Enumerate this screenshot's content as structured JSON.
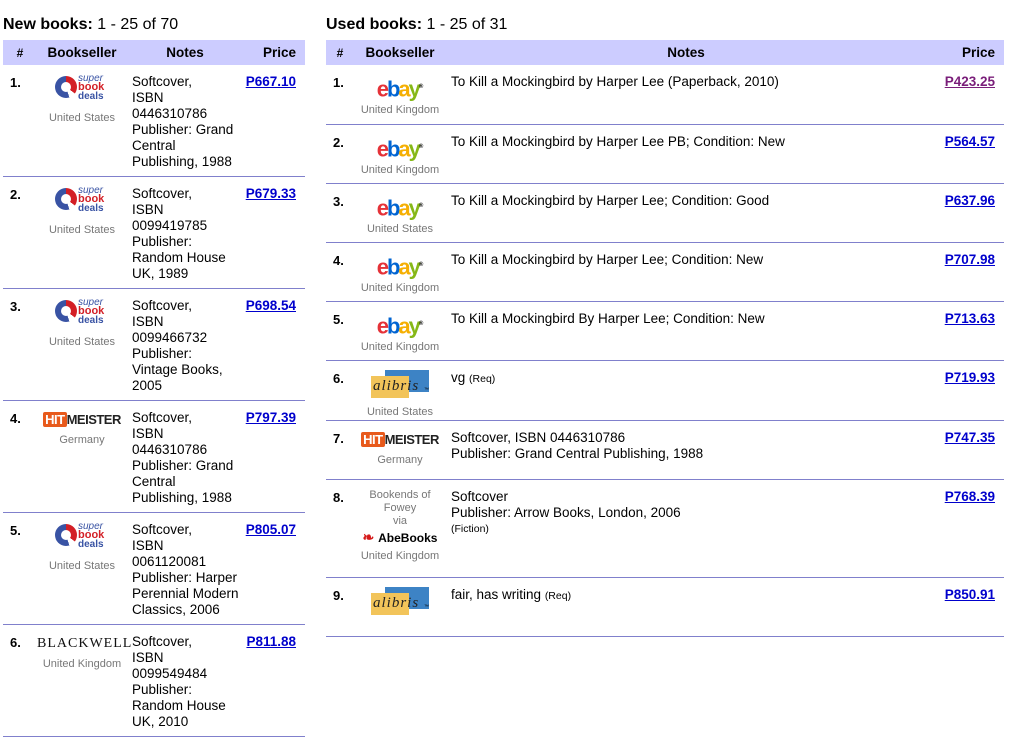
{
  "new_books": {
    "heading_bold": "New books:",
    "heading_count": "1 - 25 of 70",
    "columns": [
      "#",
      "Bookseller",
      "Notes",
      "Price"
    ],
    "rows": [
      {
        "num": "1.",
        "seller_logo": "superbookdeals-logo",
        "country": "United States",
        "notes": [
          "Softcover,",
          "ISBN 0446310786",
          "Publisher: Grand",
          "Central",
          "Publishing, 1988"
        ],
        "price": "P667.10"
      },
      {
        "num": "2.",
        "seller_logo": "superbookdeals-logo",
        "country": "United States",
        "notes": [
          "Softcover,",
          "ISBN 0099419785",
          "Publisher:",
          "Random House",
          "UK, 1989"
        ],
        "price": "P679.33"
      },
      {
        "num": "3.",
        "seller_logo": "superbookdeals-logo",
        "country": "United States",
        "notes": [
          "Softcover,",
          "ISBN 0099466732",
          "Publisher:",
          "Vintage Books,",
          "2005"
        ],
        "price": "P698.54"
      },
      {
        "num": "4.",
        "seller_logo": "hitmeister-logo",
        "country": "Germany",
        "notes": [
          "Softcover,",
          "ISBN 0446310786",
          "Publisher: Grand",
          "Central",
          "Publishing, 1988"
        ],
        "price": "P797.39"
      },
      {
        "num": "5.",
        "seller_logo": "superbookdeals-logo",
        "country": "United States",
        "notes": [
          "Softcover,",
          "ISBN 0061120081",
          "Publisher: Harper",
          "Perennial Modern",
          "Classics, 2006"
        ],
        "price": "P805.07"
      },
      {
        "num": "6.",
        "seller_logo": "blackwell-logo",
        "country": "United Kingdom",
        "notes": [
          "Softcover,",
          "ISBN 0099549484",
          "Publisher:",
          "Random House",
          "UK, 2010"
        ],
        "price": "P811.88"
      }
    ]
  },
  "used_books": {
    "heading_bold": "Used books:",
    "heading_count": "1 - 25 of 31",
    "columns": [
      "#",
      "Bookseller",
      "Notes",
      "Price"
    ],
    "rows": [
      {
        "num": "1.",
        "seller_logo": "ebay-logo",
        "country": "United Kingdom",
        "note_main": "To Kill a Mockingbird by Harper Lee (Paperback, 2010)",
        "price": "P423.25",
        "visited": true
      },
      {
        "num": "2.",
        "seller_logo": "ebay-logo",
        "country": "United Kingdom",
        "note_main": "To Kill a Mockingbird by Harper Lee PB; Condition: New",
        "price": "P564.57"
      },
      {
        "num": "3.",
        "seller_logo": "ebay-logo",
        "country": "United States",
        "note_main": "To Kill a Mockingbird by Harper Lee; Condition: Good",
        "price": "P637.96"
      },
      {
        "num": "4.",
        "seller_logo": "ebay-logo",
        "country": "United Kingdom",
        "note_main": "To Kill a Mockingbird by Harper Lee; Condition: New",
        "price": "P707.98"
      },
      {
        "num": "5.",
        "seller_logo": "ebay-logo",
        "country": "United Kingdom",
        "note_main": "To Kill a Mockingbird By Harper Lee; Condition: New",
        "price": "P713.63"
      },
      {
        "num": "6.",
        "seller_logo": "alibris-logo",
        "country": "United States",
        "note_main": "vg",
        "note_small": "(Req)",
        "price": "P719.93"
      },
      {
        "num": "7.",
        "seller_logo": "hitmeister-logo",
        "country": "Germany",
        "note_main": "Softcover, ISBN 0446310786",
        "note_line2": "Publisher: Grand Central Publishing, 1988",
        "price": "P747.35"
      },
      {
        "num": "8.",
        "seller_logo": "abebooks-logo",
        "via_seller": [
          "Bookends of",
          "Fowey"
        ],
        "via": "via",
        "country": "United Kingdom",
        "note_main": "Softcover",
        "note_line2": "Publisher: Arrow Books, London, 2006",
        "note_small_line": "(Fiction)",
        "price": "P768.39"
      },
      {
        "num": "9.",
        "seller_logo": "alibris-logo",
        "country": "",
        "note_main": "fair, has writing",
        "note_small": "(Req)",
        "price": "P850.91"
      }
    ]
  },
  "logos": {
    "superbook": [
      "super",
      "book",
      "deals"
    ],
    "hitmeister": [
      "HIT",
      "MEISTER"
    ],
    "blackwell": "BLACKWELL",
    "ebay": [
      "e",
      "b",
      "a",
      "y"
    ],
    "alibris": "alibris",
    "abebooks": "AbeBooks"
  },
  "colors": {
    "header_bg": "#ccccff",
    "link": "#0000cc",
    "visited_link": "#7a1e7a",
    "row_divider": "#8080cc"
  }
}
